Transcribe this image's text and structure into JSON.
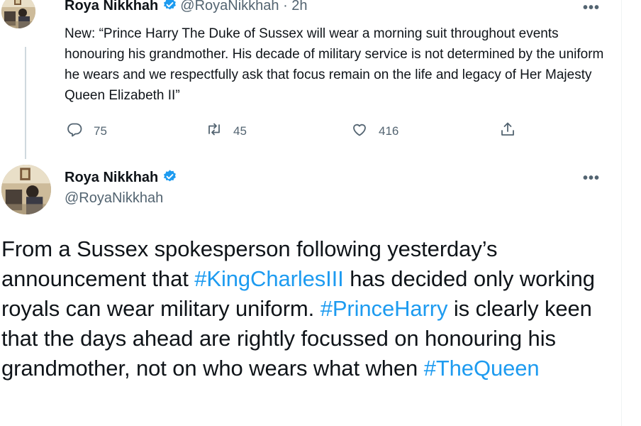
{
  "tweet1": {
    "name": "Roya Nikkhah",
    "handle_time": "@RoyaNikkhah · 2h",
    "text": "New: “Prince Harry The Duke of Sussex will wear a morning suit throughout events honouring his grandmother. His decade of military service is not determined by the uniform he wears and we respectfully ask that focus remain on the life and legacy of Her Majesty Queen Elizabeth II”",
    "replies": "75",
    "retweets": "45",
    "likes": "416",
    "more": "•••"
  },
  "tweet2": {
    "name": "Roya Nikkhah",
    "handle": "@RoyaNikkhah",
    "more": "•••",
    "text_parts": {
      "p1": "From a Sussex spokesperson following yesterday’s announcement that ",
      "tag1": "#KingCharlesIII",
      "p2": " has decided only working royals can wear military uniform. ",
      "tag2": "#PrinceHarry",
      "p3": " is clearly keen that the days ahead are rightly focussed on honouring his grandmother, not on who wears what when ",
      "tag3": "#TheQueen"
    }
  },
  "colors": {
    "accent": "#1d9bf0",
    "secondary_text": "#536471",
    "text": "#0f1419"
  },
  "icons": [
    "verified-badge-icon",
    "more-icon",
    "reply-icon",
    "retweet-icon",
    "like-icon",
    "share-icon"
  ]
}
